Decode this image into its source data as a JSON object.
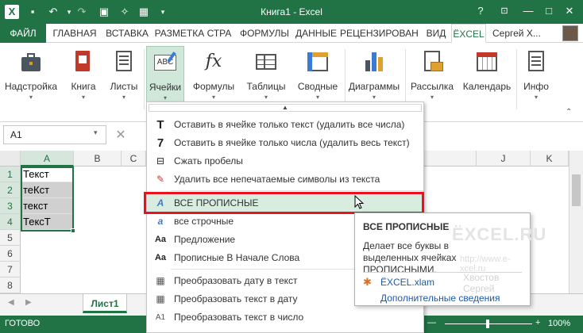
{
  "window": {
    "title": "Книга1 - Excel",
    "help": "?",
    "restore_icon": "ribbon-display-icon",
    "minimize": "—",
    "maximize": "□",
    "close": "✕"
  },
  "quick_access": [
    "excel-logo-icon",
    "save-icon",
    "undo-icon",
    "redo-icon",
    "camera-icon",
    "wand-icon",
    "table-icon",
    "customize-icon"
  ],
  "tabs": [
    "ФАЙЛ",
    "ГЛАВНАЯ",
    "ВСТАВКА",
    "РАЗМЕТКА СТРА",
    "ФОРМУЛЫ",
    "ДАННЫЕ",
    "РЕЦЕНЗИРОВАН",
    "ВИД",
    "ЁXCEL"
  ],
  "user": "Сергей Х...",
  "ribbon": [
    {
      "label": "Надстройка",
      "icon": "toolbox-icon"
    },
    {
      "label": "Книга",
      "icon": "book-icon"
    },
    {
      "label": "Листы",
      "icon": "sheets-icon"
    },
    {
      "label": "Ячейки",
      "icon": "abc-cells-icon"
    },
    {
      "label": "Формулы",
      "icon": "fx-icon"
    },
    {
      "label": "Таблицы",
      "icon": "tables-icon"
    },
    {
      "label": "Сводные",
      "icon": "pivot-icon"
    },
    {
      "label": "Диаграммы",
      "icon": "chart-icon"
    },
    {
      "label": "Рассылка",
      "icon": "mailing-icon"
    },
    {
      "label": "Календарь",
      "icon": "calendar-icon"
    },
    {
      "label": "Инфо",
      "icon": "info-icon"
    }
  ],
  "namebox": "A1",
  "columns": [
    "A",
    "B",
    "C",
    "",
    "",
    "",
    "",
    "",
    "J",
    "K"
  ],
  "rows": [
    "1",
    "2",
    "3",
    "4",
    "5",
    "6",
    "7",
    "8"
  ],
  "cells": [
    "Текст",
    "теКст",
    "текст",
    "ТексТ"
  ],
  "sheet_tab": "Лист1",
  "status": {
    "ready": "ГОТОВО",
    "zoom": "100%",
    "minus": "—",
    "plus": "+"
  },
  "menu": [
    {
      "icon": "T",
      "text": "Оставить в ячейке только текст (удалить все числа)"
    },
    {
      "icon": "7",
      "text": "Оставить в ячейке только числа (удалить весь текст)"
    },
    {
      "icon": "⊟",
      "text": "Сжать пробелы"
    },
    {
      "icon": "✎",
      "text": "Удалить все непечатаемые символы из текста"
    },
    {
      "icon": "A",
      "text": "ВСЕ ПРОПИСНЫЕ"
    },
    {
      "icon": "a",
      "text": "все строчные"
    },
    {
      "icon": "Aa",
      "text": "Предложение"
    },
    {
      "icon": "Aa",
      "text": "Прописные В Начале Слова"
    },
    {
      "icon": "▦",
      "text": "Преобразовать дату в текст"
    },
    {
      "icon": "▦",
      "text": "Преобразовать текст в дату"
    },
    {
      "icon": "A1",
      "text": "Преобразовать текст в число"
    }
  ],
  "tooltip": {
    "title": "ВСЕ ПРОПИСНЫЕ",
    "body": "Делает все буквы в выделенных ячейках ПРОПИСНЫМИ.",
    "addin": "ЁXCEL.xlam",
    "link": "Дополнительные сведения",
    "watermark_logo": "ЁXCEL.RU",
    "watermark_url": "http://www.e-xcel.ru",
    "watermark_author": "Хвостов Сергей"
  },
  "colors": {
    "brand": "#217346",
    "highlight": "#e8131f",
    "selected": "#cfe8d9"
  }
}
